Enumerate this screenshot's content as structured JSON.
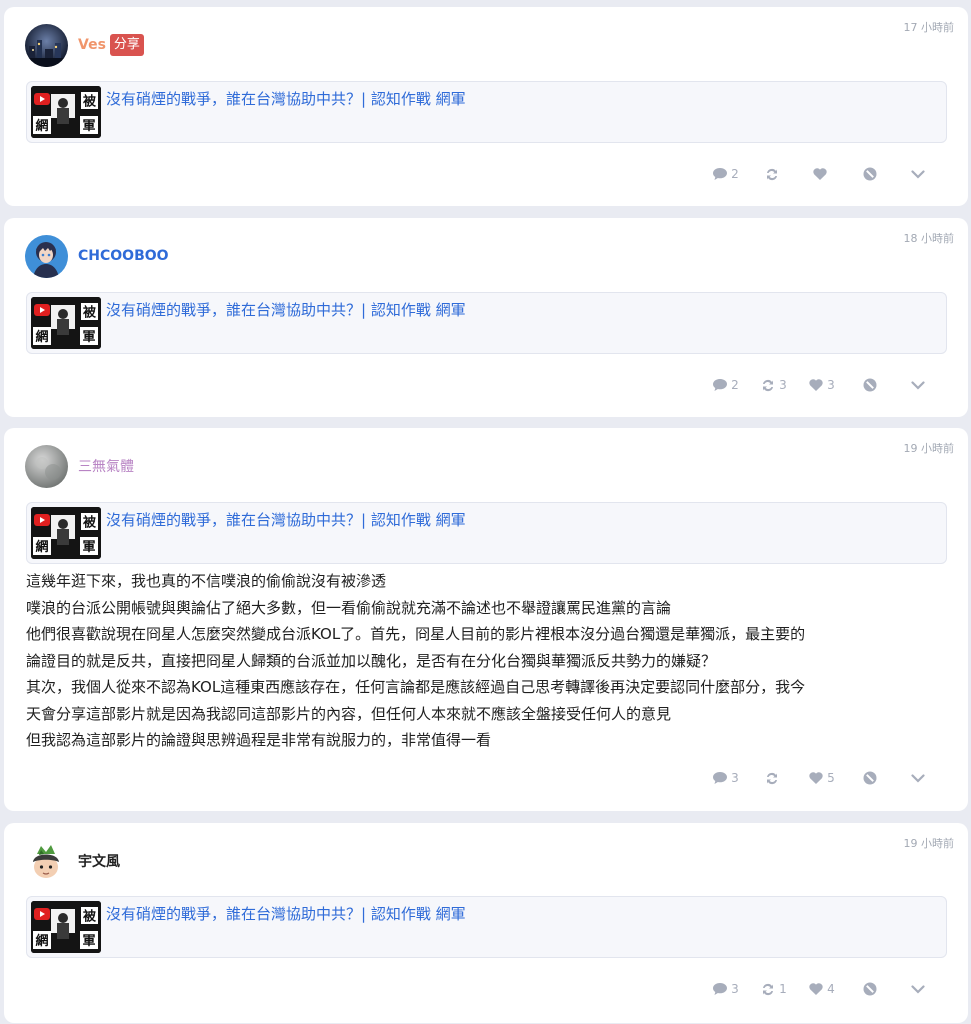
{
  "posts": [
    {
      "author": "Ves",
      "author_color": "#f0956b",
      "share_label": "分享",
      "time": "17 小時前",
      "avatar_icon": "night-city-avatar",
      "link_title": "沒有硝煙的戰爭，誰在台灣協助中共？| 認知作戰 網軍",
      "text": [],
      "stats": {
        "comments": "2",
        "reposts": "",
        "likes": ""
      }
    },
    {
      "author": "CHCOOBOO",
      "author_color": "#2f6bd8",
      "share_label": "",
      "time": "18 小時前",
      "avatar_icon": "anime-character-avatar",
      "link_title": "沒有硝煙的戰爭，誰在台灣協助中共？| 認知作戰 網軍",
      "text": [],
      "stats": {
        "comments": "2",
        "reposts": "3",
        "likes": "3"
      }
    },
    {
      "author": "三無氣體",
      "author_color": "#b884c4",
      "share_label": "",
      "time": "19 小時前",
      "avatar_icon": "gray-orb-avatar",
      "link_title": "沒有硝煙的戰爭，誰在台灣協助中共？| 認知作戰 網軍",
      "text": [
        "這幾年逛下來，我也真的不信噗浪的偷偷說沒有被滲透",
        "噗浪的台派公開帳號與輿論佔了絕大多數，但一看偷偷說就充滿不論述也不舉證讓罵民進黨的言論",
        "他們很喜歡說現在冏星人怎麼突然變成台派KOL了。首先，冏星人目前的影片裡根本沒分過台獨還是華獨派，最主要的",
        "論證目的就是反共，直接把冏星人歸類的台派並加以醜化，是否有在分化台獨與華獨派反共勢力的嫌疑？",
        "其次，我個人從來不認為KOL這種東西應該存在，任何言論都是應該經過自己思考轉譯後再決定要認同什麼部分，我今",
        "天會分享這部影片就是因為我認同這部影片的內容，但任何人本來就不應該全盤接受任何人的意見",
        "但我認為這部影片的論證與思辨過程是非常有說服力的，非常值得一看"
      ],
      "stats": {
        "comments": "3",
        "reposts": "",
        "likes": "5"
      }
    },
    {
      "author": "宇文風",
      "author_color": "#222222",
      "share_label": "",
      "time": "19 小時前",
      "avatar_icon": "green-hat-character-avatar",
      "link_title": "沒有硝煙的戰爭，誰在台灣協助中共？| 認知作戰 網軍",
      "text": [],
      "stats": {
        "comments": "3",
        "reposts": "1",
        "likes": "4"
      }
    }
  ],
  "thumbnail": {
    "top_right": "被",
    "bottom_left": "網",
    "bottom_right": "軍"
  },
  "colors": {
    "link": "#2f6bd8",
    "icon": "#a7adbb",
    "badge": "#d9534f",
    "background": "#e9ebf2"
  }
}
